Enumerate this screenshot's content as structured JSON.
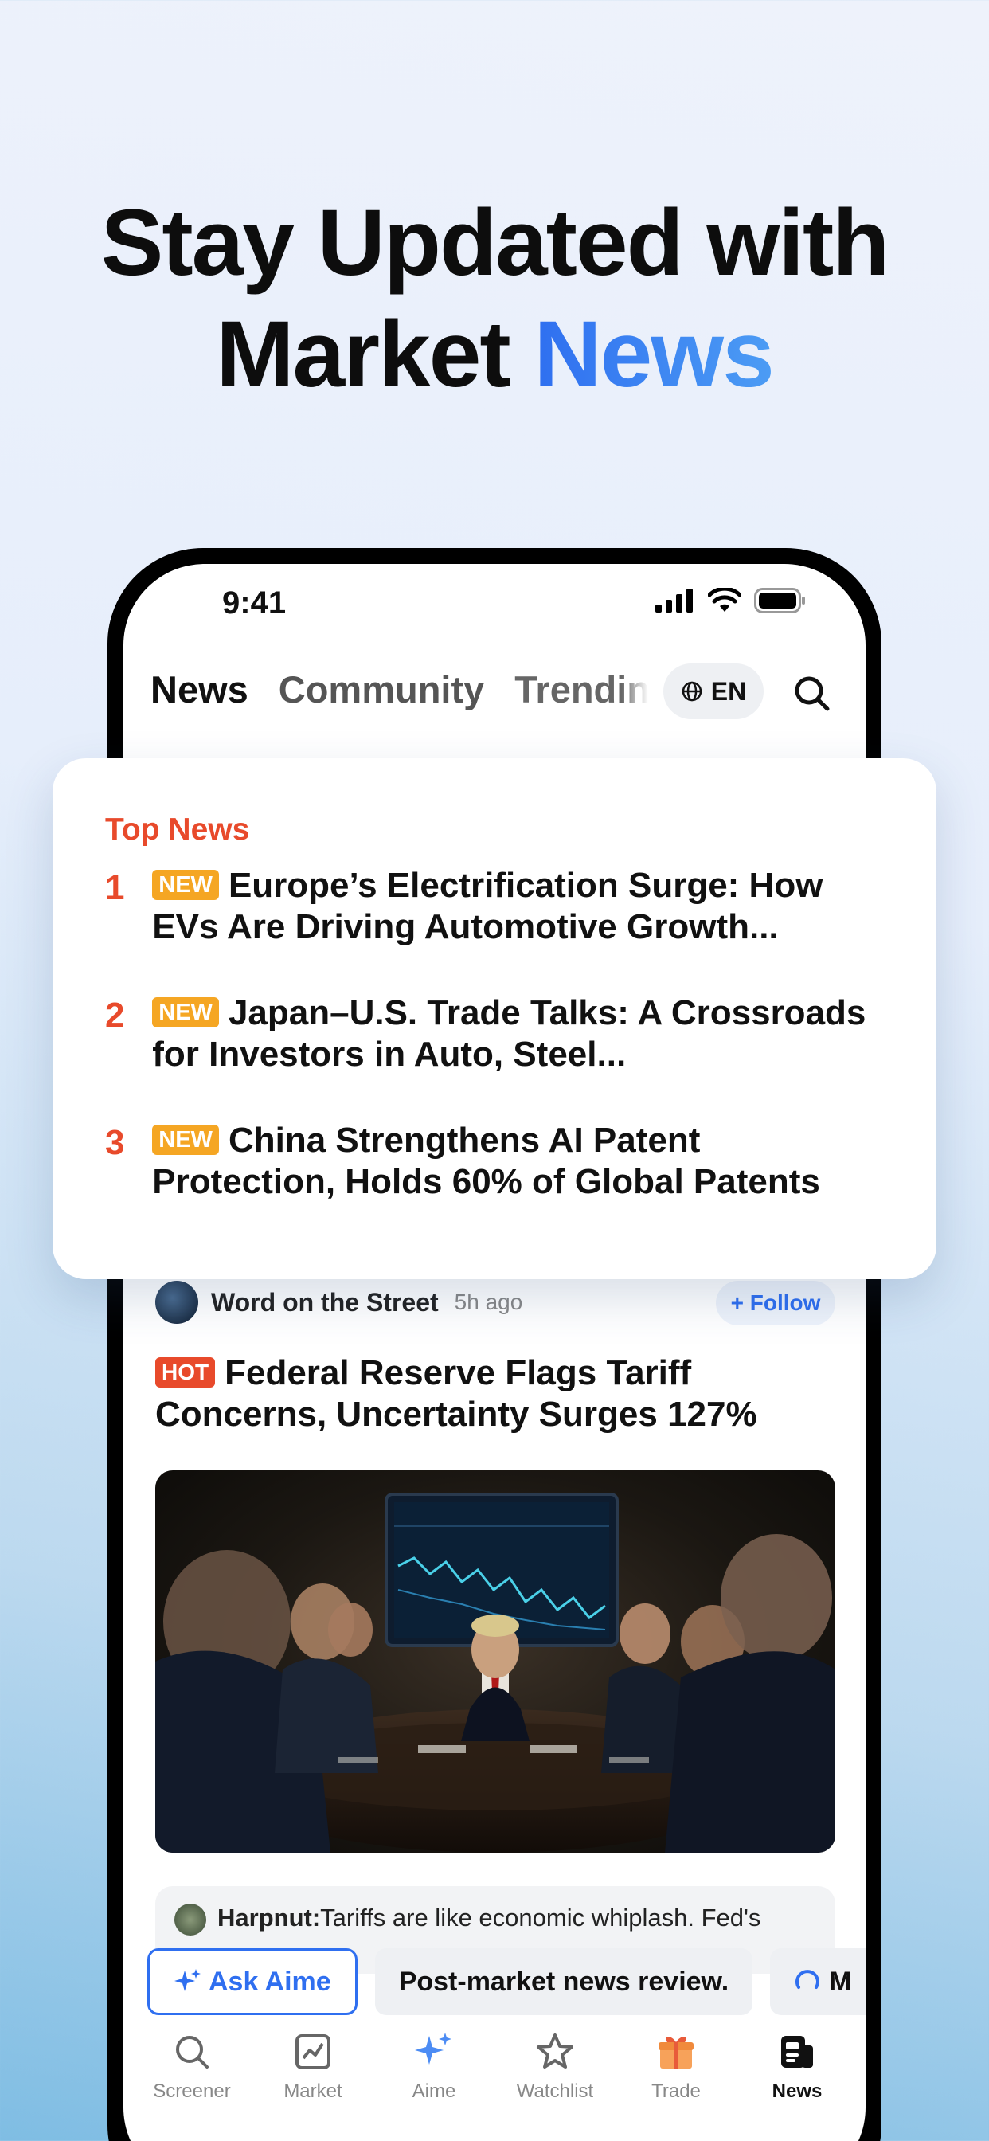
{
  "headline": {
    "line1": "Stay Updated with",
    "line2_plain": "Market ",
    "line2_accent": "News"
  },
  "status_bar": {
    "time": "9:41"
  },
  "tabs": [
    {
      "label": "News",
      "active": true
    },
    {
      "label": "Community",
      "active": false
    },
    {
      "label": "Trending",
      "active": false
    }
  ],
  "language": {
    "label": "EN"
  },
  "top_news": {
    "title": "Top News",
    "badge": "NEW",
    "items": [
      {
        "rank": "1",
        "text": "Europe’s Electrification Surge: How EVs Are Driving Automotive Growth..."
      },
      {
        "rank": "2",
        "text": "Japan–U.S. Trade Talks: A Crossroads for Investors in Auto, Steel..."
      },
      {
        "rank": "3",
        "text": "China Strengthens AI Patent Protection, Holds 60% of Global Patents"
      }
    ]
  },
  "feed_post": {
    "author": "Word on the Street",
    "time": "5h ago",
    "follow_label": "+ Follow",
    "badge": "HOT",
    "title": "Federal Reserve Flags Tariff Concerns, Uncertainty Surges 127%",
    "comment_user": "Harpnut:",
    "comment_text": "Tariffs are like economic whiplash. Fed's"
  },
  "chips": {
    "ask_aime": "Ask Aime",
    "review": "Post-market news review.",
    "more": "M"
  },
  "tabbar": [
    {
      "label": "Screener",
      "icon": "search-icon"
    },
    {
      "label": "Market",
      "icon": "chart-icon"
    },
    {
      "label": "Aime",
      "icon": "sparkle-icon"
    },
    {
      "label": "Watchlist",
      "icon": "star-icon"
    },
    {
      "label": "Trade",
      "icon": "gift-icon"
    },
    {
      "label": "News",
      "icon": "news-icon",
      "active": true
    }
  ],
  "colors": {
    "accent": "#2f6ff0",
    "red": "#e84a2b",
    "new_badge": "#f5a623"
  }
}
